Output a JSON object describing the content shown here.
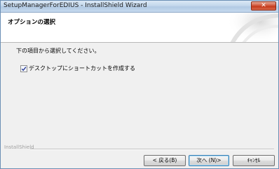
{
  "window": {
    "title": "SetupManagerForEDIUS - InstallShield Wizard",
    "close_glyph": "✕"
  },
  "header": {
    "title": "オプションの選択"
  },
  "content": {
    "instruction": "下の項目から選択してください。",
    "checkbox": {
      "label": "デスクトップにショートカットを作成する",
      "checked": true
    }
  },
  "footer": {
    "brand": "InstallShield",
    "buttons": {
      "back": "< 戻る(B)",
      "next": "次へ (N)>",
      "cancel": "ｷｬﾝｾﾙ"
    }
  },
  "colors": {
    "accent": "#3c7fb1",
    "close": "#c4391a"
  }
}
